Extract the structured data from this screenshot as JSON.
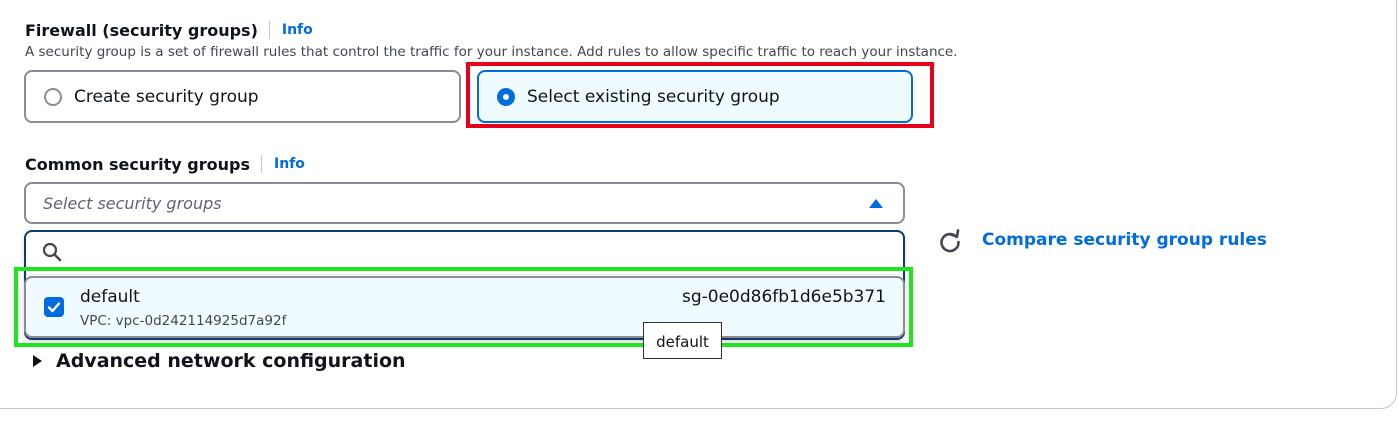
{
  "firewall": {
    "title": "Firewall (security groups)",
    "info_label": "Info",
    "description": "A security group is a set of firewall rules that control the traffic for your instance. Add rules to allow specific traffic to reach your instance.",
    "options": [
      {
        "label": "Create security group",
        "selected": false
      },
      {
        "label": "Select existing security group",
        "selected": true
      }
    ]
  },
  "common_groups": {
    "title": "Common security groups",
    "info_label": "Info",
    "placeholder": "Select security groups",
    "search_placeholder": "",
    "items": [
      {
        "name": "default",
        "vpc": "VPC: vpc-0d242114925d7a92f",
        "id": "sg-0e0d86fb1d6e5b371",
        "checked": true
      }
    ],
    "tooltip": "default",
    "compare_label": "Compare security group rules"
  },
  "advanced": {
    "label": "Advanced network configuration"
  },
  "colors": {
    "accent": "#006ce0",
    "highlight_red": "#e8001a",
    "highlight_green": "#1ee61e"
  }
}
